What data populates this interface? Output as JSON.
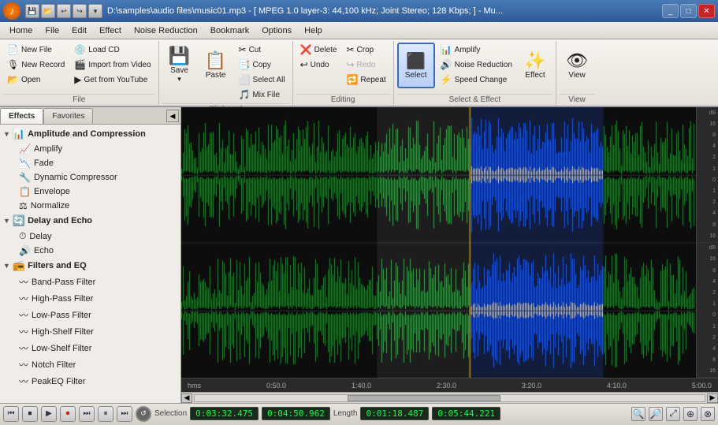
{
  "titlebar": {
    "title": "D:\\samples\\audio files\\music01.mp3 - [ MPEG 1.0 layer-3: 44,100 kHz; Joint Stereo; 128 Kbps; ] - Mu...",
    "logo": "♪"
  },
  "menubar": {
    "items": [
      "Home",
      "File",
      "Edit",
      "Effect",
      "Noise Reduction",
      "Bookmark",
      "Options",
      "Help"
    ]
  },
  "ribbon": {
    "groups": [
      {
        "label": "File",
        "buttons": [
          {
            "id": "new-file",
            "label": "New File",
            "icon": "📄"
          },
          {
            "id": "new-record",
            "label": "New Record",
            "icon": "🎙"
          },
          {
            "id": "open",
            "label": "Open",
            "icon": "📂"
          },
          {
            "id": "load-cd",
            "label": "Load CD",
            "icon": "💿"
          },
          {
            "id": "import-video",
            "label": "Import from Video",
            "icon": "🎬"
          },
          {
            "id": "get-youtube",
            "label": "Get from YouTube",
            "icon": "▶"
          }
        ]
      },
      {
        "label": "Clipboard",
        "buttons": [
          {
            "id": "save",
            "label": "Save",
            "icon": "💾"
          },
          {
            "id": "paste",
            "label": "Paste",
            "icon": "📋"
          },
          {
            "id": "cut",
            "label": "Cut",
            "icon": "✂"
          },
          {
            "id": "copy",
            "label": "Copy",
            "icon": "📑"
          },
          {
            "id": "select-all",
            "label": "Select All",
            "icon": "⬜"
          },
          {
            "id": "mix-file",
            "label": "Mix File",
            "icon": "🎵"
          }
        ]
      },
      {
        "label": "Editing",
        "buttons": [
          {
            "id": "delete",
            "label": "Delete",
            "icon": "❌"
          },
          {
            "id": "undo",
            "label": "Undo",
            "icon": "↩"
          },
          {
            "id": "crop",
            "label": "Crop",
            "icon": "✂"
          },
          {
            "id": "redo",
            "label": "Redo",
            "icon": "↪"
          },
          {
            "id": "repeat",
            "label": "Repeat",
            "icon": "🔁"
          }
        ]
      },
      {
        "label": "Select & Effect",
        "buttons": [
          {
            "id": "select",
            "label": "Select",
            "icon": "⬛"
          },
          {
            "id": "amplify",
            "label": "Amplify",
            "icon": "📊"
          },
          {
            "id": "noise-reduction",
            "label": "Noise Reduction",
            "icon": "🔊"
          },
          {
            "id": "speed-change",
            "label": "Speed Change",
            "icon": "⚡"
          },
          {
            "id": "effect",
            "label": "Effect",
            "icon": "✨"
          }
        ]
      },
      {
        "label": "View",
        "buttons": [
          {
            "id": "view",
            "label": "View",
            "icon": "👁"
          }
        ]
      }
    ]
  },
  "leftpanel": {
    "tabs": [
      "Effects",
      "Favorites"
    ],
    "tree": [
      {
        "id": "amplitude-compression",
        "label": "Amplitude and Compression",
        "expanded": true,
        "children": [
          {
            "id": "amplify",
            "label": "Amplify"
          },
          {
            "id": "fade",
            "label": "Fade"
          },
          {
            "id": "dynamic-compressor",
            "label": "Dynamic Compressor"
          },
          {
            "id": "envelope",
            "label": "Envelope"
          },
          {
            "id": "normalize",
            "label": "Normalize"
          }
        ]
      },
      {
        "id": "delay-echo",
        "label": "Delay and Echo",
        "expanded": true,
        "children": [
          {
            "id": "delay",
            "label": "Delay"
          },
          {
            "id": "echo",
            "label": "Echo"
          }
        ]
      },
      {
        "id": "filters-eq",
        "label": "Filters and EQ",
        "expanded": true,
        "children": [
          {
            "id": "band-pass",
            "label": "Band-Pass Filter"
          },
          {
            "id": "high-pass",
            "label": "High-Pass Filter"
          },
          {
            "id": "low-pass",
            "label": "Low-Pass Filter"
          },
          {
            "id": "high-shelf",
            "label": "High-Shelf Filter"
          },
          {
            "id": "low-shelf",
            "label": "Low-Shelf Filter"
          },
          {
            "id": "notch",
            "label": "Notch Filter"
          },
          {
            "id": "peakeq",
            "label": "PeakEQ Filter"
          }
        ]
      }
    ]
  },
  "timeline": {
    "labels": [
      "hms",
      "0:50.0",
      "1:40.0",
      "2:30.0",
      "3:20.0",
      "4:10.0",
      "5:00.0"
    ]
  },
  "db_scale": {
    "labels": [
      "dB",
      "16",
      "8",
      "4",
      "2",
      "1",
      "0",
      "1",
      "2",
      "4",
      "8",
      "16"
    ]
  },
  "statusbar": {
    "transport_buttons": [
      "⏮",
      "⏹",
      "⏵",
      "⏺",
      "⏭",
      "⏸",
      "⏭"
    ],
    "selection_label": "Selection",
    "selection_start": "0:03:32.475",
    "selection_end": "0:04:50.962",
    "length_label": "Length",
    "length_value": "0:01:18.487",
    "total_length": "0:05:44.221"
  },
  "waveform": {
    "selection_start_pct": 0.38,
    "selection_end_pct": 0.56,
    "highlight_start_pct": 0.56,
    "highlight_end_pct": 0.82
  }
}
